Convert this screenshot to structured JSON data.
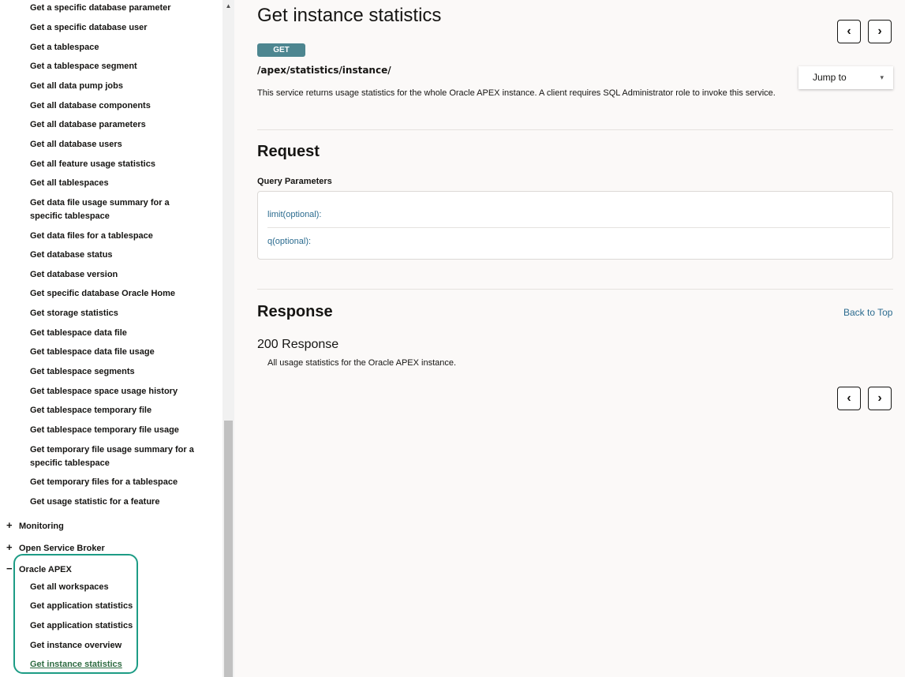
{
  "sidebar": {
    "items": [
      "Get a specific database parameter",
      "Get a specific database user",
      "Get a tablespace",
      "Get a tablespace segment",
      "Get all data pump jobs",
      "Get all database components",
      "Get all database parameters",
      "Get all database users",
      "Get all feature usage statistics",
      "Get all tablespaces",
      "Get data file usage summary for a specific tablespace",
      "Get data files for a tablespace",
      "Get database status",
      "Get database version",
      "Get specific database Oracle Home",
      "Get storage statistics",
      "Get tablespace data file",
      "Get tablespace data file usage",
      "Get tablespace segments",
      "Get tablespace space usage history",
      "Get tablespace temporary file",
      "Get tablespace temporary file usage",
      "Get temporary file usage summary for a specific tablespace",
      "Get temporary files for a tablespace",
      "Get usage statistic for a feature"
    ],
    "sections": [
      {
        "toggle": "+",
        "label": "Monitoring"
      },
      {
        "toggle": "+",
        "label": "Open Service Broker"
      },
      {
        "toggle": "−",
        "label": "Oracle APEX"
      }
    ],
    "apex_items": [
      "Get all workspaces",
      "Get application statistics",
      "Get application statistics",
      "Get instance overview",
      "Get instance statistics"
    ]
  },
  "scrollbar": {
    "up_arrow": "▲"
  },
  "main": {
    "title": "Get instance statistics",
    "method": "GET",
    "path": "/apex/statistics/instance/",
    "description": "This service returns usage statistics for the whole Oracle APEX instance. A client requires SQL Administrator role to invoke this service.",
    "jump_to": "Jump to",
    "jump_caret": "▾",
    "prev_icon": "‹",
    "next_icon": "›",
    "request_title": "Request",
    "query_params_label": "Query Parameters",
    "params": [
      "limit(optional):",
      "q(optional):"
    ],
    "response_title": "Response",
    "back_to_top": "Back to Top",
    "response_code": "200 Response",
    "response_desc": "All usage statistics for the Oracle APEX instance."
  }
}
